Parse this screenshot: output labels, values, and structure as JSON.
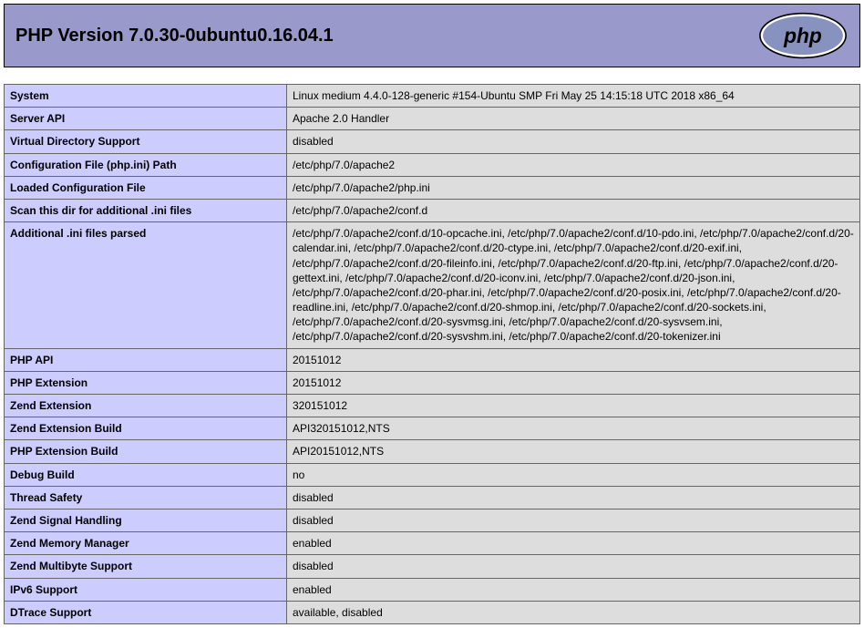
{
  "header": {
    "title": "PHP Version 7.0.30-0ubuntu0.16.04.1"
  },
  "rows": [
    {
      "label": "System",
      "value": "Linux medium 4.4.0-128-generic #154-Ubuntu SMP Fri May 25 14:15:18 UTC 2018 x86_64"
    },
    {
      "label": "Server API",
      "value": "Apache 2.0 Handler"
    },
    {
      "label": "Virtual Directory Support",
      "value": "disabled"
    },
    {
      "label": "Configuration File (php.ini) Path",
      "value": "/etc/php/7.0/apache2"
    },
    {
      "label": "Loaded Configuration File",
      "value": "/etc/php/7.0/apache2/php.ini"
    },
    {
      "label": "Scan this dir for additional .ini files",
      "value": "/etc/php/7.0/apache2/conf.d"
    },
    {
      "label": "Additional .ini files parsed",
      "value": "/etc/php/7.0/apache2/conf.d/10-opcache.ini, /etc/php/7.0/apache2/conf.d/10-pdo.ini, /etc/php/7.0/apache2/conf.d/20-calendar.ini, /etc/php/7.0/apache2/conf.d/20-ctype.ini, /etc/php/7.0/apache2/conf.d/20-exif.ini, /etc/php/7.0/apache2/conf.d/20-fileinfo.ini, /etc/php/7.0/apache2/conf.d/20-ftp.ini, /etc/php/7.0/apache2/conf.d/20-gettext.ini, /etc/php/7.0/apache2/conf.d/20-iconv.ini, /etc/php/7.0/apache2/conf.d/20-json.ini, /etc/php/7.0/apache2/conf.d/20-phar.ini, /etc/php/7.0/apache2/conf.d/20-posix.ini, /etc/php/7.0/apache2/conf.d/20-readline.ini, /etc/php/7.0/apache2/conf.d/20-shmop.ini, /etc/php/7.0/apache2/conf.d/20-sockets.ini, /etc/php/7.0/apache2/conf.d/20-sysvmsg.ini, /etc/php/7.0/apache2/conf.d/20-sysvsem.ini, /etc/php/7.0/apache2/conf.d/20-sysvshm.ini, /etc/php/7.0/apache2/conf.d/20-tokenizer.ini"
    },
    {
      "label": "PHP API",
      "value": "20151012"
    },
    {
      "label": "PHP Extension",
      "value": "20151012"
    },
    {
      "label": "Zend Extension",
      "value": "320151012"
    },
    {
      "label": "Zend Extension Build",
      "value": "API320151012,NTS"
    },
    {
      "label": "PHP Extension Build",
      "value": "API20151012,NTS"
    },
    {
      "label": "Debug Build",
      "value": "no"
    },
    {
      "label": "Thread Safety",
      "value": "disabled"
    },
    {
      "label": "Zend Signal Handling",
      "value": "disabled"
    },
    {
      "label": "Zend Memory Manager",
      "value": "enabled"
    },
    {
      "label": "Zend Multibyte Support",
      "value": "disabled"
    },
    {
      "label": "IPv6 Support",
      "value": "enabled"
    },
    {
      "label": "DTrace Support",
      "value": "available, disabled"
    }
  ]
}
